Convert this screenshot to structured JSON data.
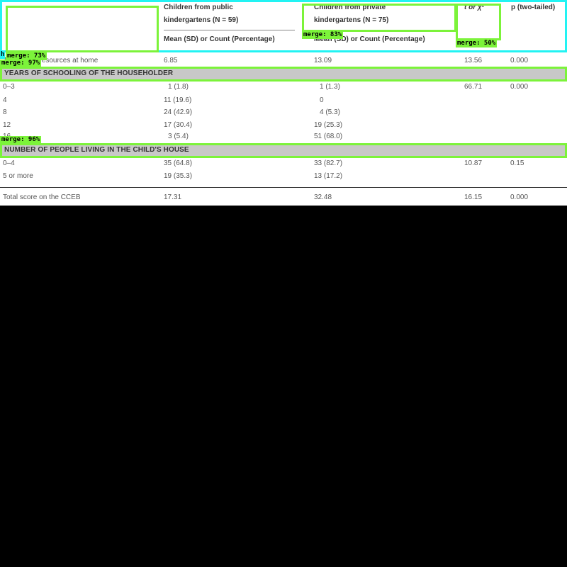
{
  "table": {
    "header": {
      "public_group": [
        "Children from public",
        "kindergartens (N = 59)"
      ],
      "private_group": [
        "Children from private",
        "kindergartens (N = 75)"
      ],
      "stat_col": "t or χ²",
      "p_col": "p (two-tailed)",
      "public_sub": "Mean (SD) or Count (Percentage)",
      "private_sub": "Mean (SD) or Count (Percentage)"
    },
    "resources_row": {
      "label": "Number of resources at home",
      "public": "6.85",
      "private": "13.09",
      "stat": "13.56",
      "p": "0.000"
    },
    "section_schooling": {
      "title": "YEARS OF SCHOOLING OF THE HOUSEHOLDER",
      "rows": [
        {
          "label": "0–3",
          "public": "1 (1.8)",
          "private": "1 (1.3)",
          "stat": "66.71",
          "p": "0.000"
        },
        {
          "label": "4",
          "public": "11 (19.6)",
          "private": "0",
          "stat": "",
          "p": ""
        },
        {
          "label": "8",
          "public": "24 (42.9)",
          "private": "4 (5.3)",
          "stat": "",
          "p": ""
        },
        {
          "label": "12",
          "public": "17 (30.4)",
          "private": "19 (25.3)",
          "stat": "",
          "p": ""
        },
        {
          "label": "16",
          "public": "3 (5.4)",
          "private": "51 (68.0)",
          "stat": "",
          "p": ""
        }
      ]
    },
    "section_people": {
      "title": "NUMBER OF PEOPLE LIVING IN THE CHILD'S HOUSE",
      "rows": [
        {
          "label": "0–4",
          "public": "35 (64.8)",
          "private": "33 (82.7)",
          "stat": "10.87",
          "p": "0.15"
        },
        {
          "label": "5 or more",
          "public": "19 (35.3)",
          "private": "13 (17.2)",
          "stat": "",
          "p": ""
        }
      ]
    },
    "total_row": {
      "label": "Total score on the CCEB",
      "public": "17.31",
      "private": "32.48",
      "stat": "16.15",
      "p": "0.000"
    }
  },
  "overlays": {
    "merge_private_header": "merge: 83%",
    "merge_stat_header": "merge: 50%",
    "merge_empty_header": "merge: 73%",
    "merge_resources": "merge: 97%",
    "merge_people_section": "merge: 96%",
    "corner_mark": "h"
  },
  "colors": {
    "overlay_green": "#7cf33a",
    "overlay_cyan": "#22f3f3",
    "section_band": "#c8c8c8",
    "background": "#000000"
  }
}
